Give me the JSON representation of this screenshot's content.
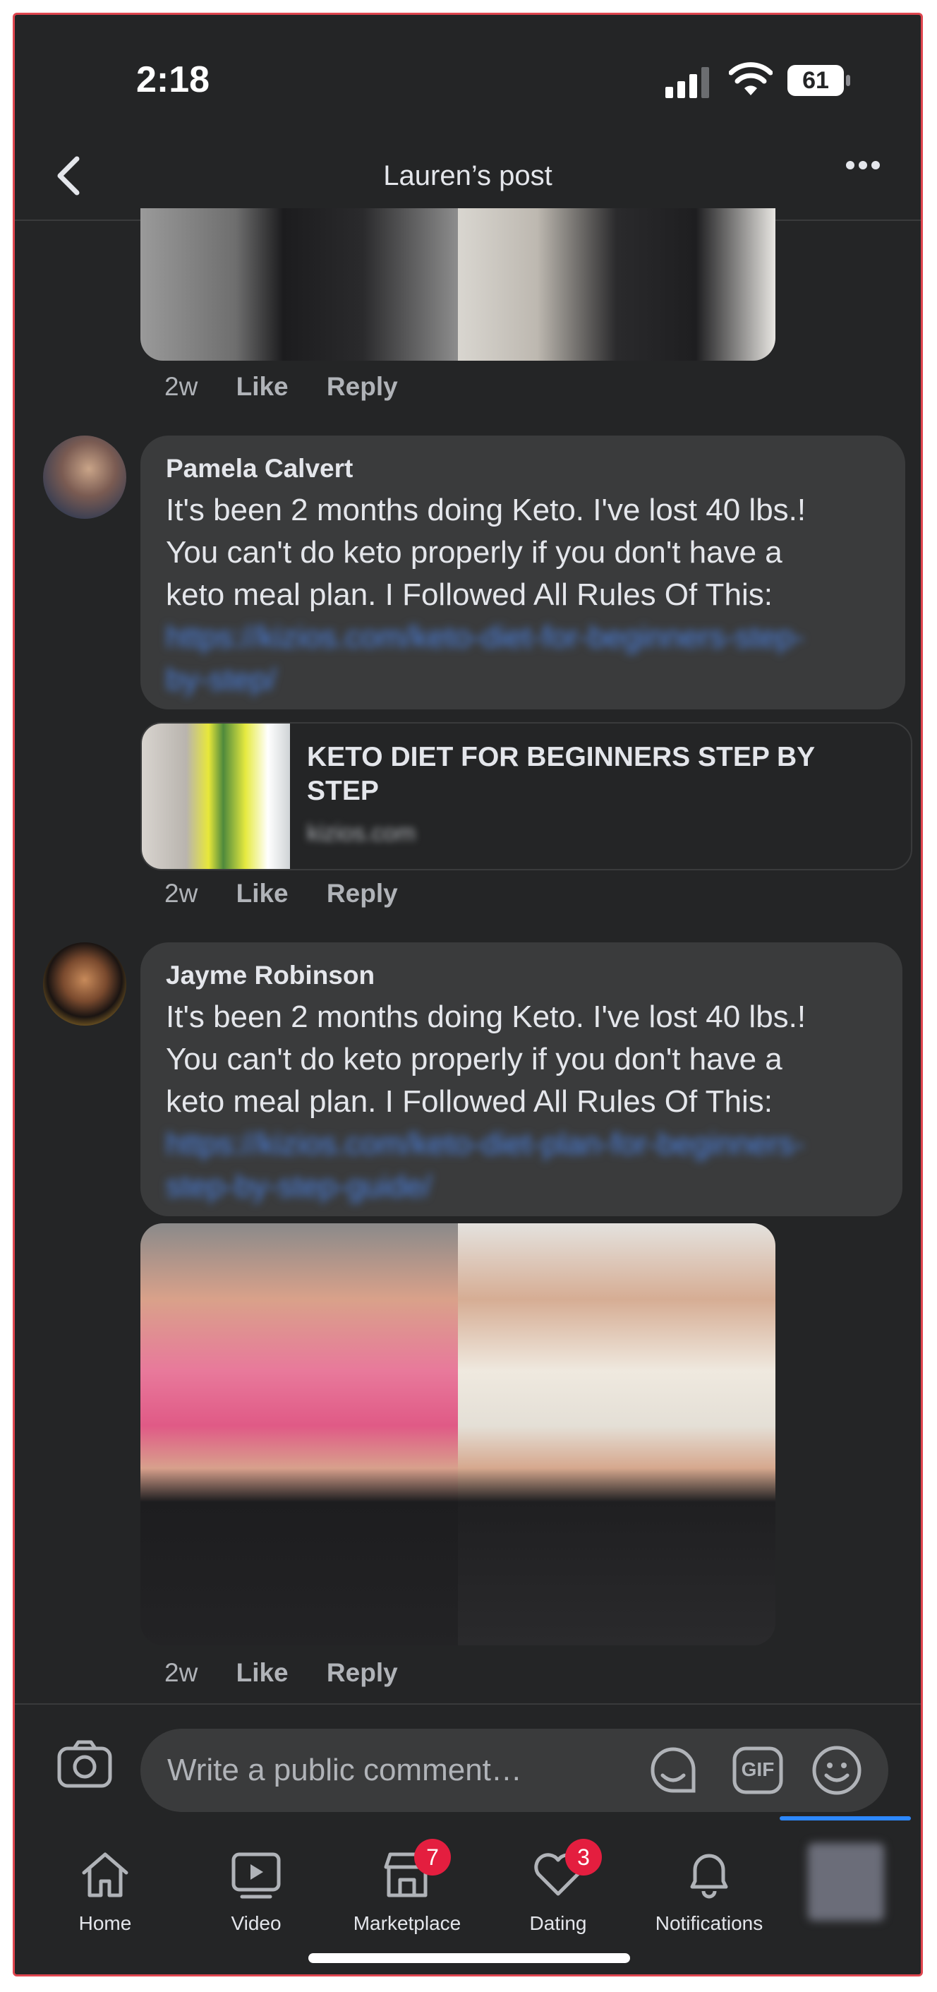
{
  "status_bar": {
    "time": "2:18",
    "battery": "61"
  },
  "header": {
    "title": "Lauren’s post"
  },
  "first_comment_meta": {
    "time": "2w",
    "like": "Like",
    "reply": "Reply"
  },
  "comments": [
    {
      "author": "Pamela Calvert",
      "text_lines": [
        "It's been 2 months doing Keto. I've lost 40 lbs.!",
        "You can't do keto properly if you don't have a",
        "keto meal plan. I Followed All Rules Of This:"
      ],
      "link_lines": [
        "https://kizios.com/keto-diet-for-beginners-step-",
        "by-step/"
      ],
      "link_preview": {
        "title": "KETO DIET FOR BEGINNERS STEP BY STEP",
        "domain": "kizios.com"
      },
      "time": "2w",
      "like": "Like",
      "reply": "Reply"
    },
    {
      "author": "Jayme Robinson",
      "text_lines": [
        "It's been 2 months doing Keto. I've lost 40 lbs.!",
        "You can't do keto properly if you don't have a",
        "keto meal plan. I Followed All Rules Of This:"
      ],
      "link_lines": [
        "https://kizios.com/keto-diet-plan-for-beginners-",
        "step-by-step-guide/"
      ],
      "time": "2w",
      "like": "Like",
      "reply": "Reply"
    }
  ],
  "composer": {
    "placeholder": "Write a public comment…",
    "gif_label": "GIF"
  },
  "tabbar": {
    "items": [
      {
        "label": "Home",
        "icon": "home-icon"
      },
      {
        "label": "Video",
        "icon": "video-icon"
      },
      {
        "label": "Marketplace",
        "icon": "marketplace-icon",
        "badge": "7"
      },
      {
        "label": "Dating",
        "icon": "dating-icon",
        "badge": "3"
      },
      {
        "label": "Notifications",
        "icon": "bell-icon"
      }
    ]
  },
  "colors": {
    "background": "#242526",
    "bubble": "#3a3b3c",
    "badge": "#e41e3f",
    "accent": "#2d88ff",
    "link": "#4b83e6"
  }
}
